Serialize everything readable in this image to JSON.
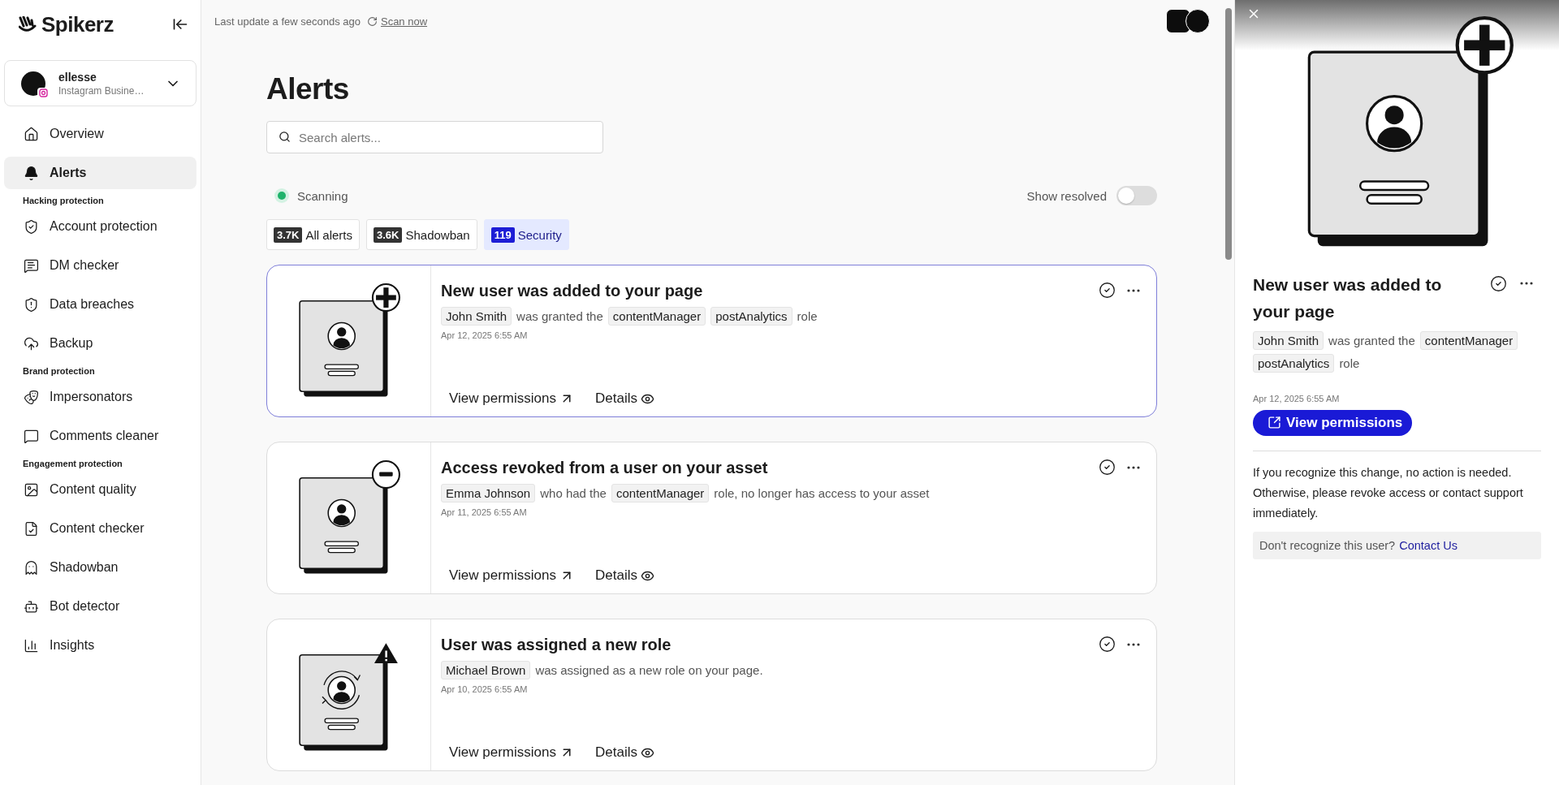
{
  "sidebar": {
    "logo": "Spikerz",
    "account": {
      "name": "ellesse",
      "subtitle": "Instagram Busine…"
    },
    "nav": [
      {
        "label": "Overview",
        "selected": false
      },
      {
        "label": "Alerts",
        "selected": true
      }
    ],
    "sections": [
      {
        "heading": "Hacking protection",
        "items": [
          {
            "label": "Account protection",
            "selected": false
          },
          {
            "label": "DM checker",
            "selected": false
          },
          {
            "label": "Data breaches",
            "selected": false
          },
          {
            "label": "Backup",
            "selected": false
          }
        ]
      },
      {
        "heading": "Brand protection",
        "items": [
          {
            "label": "Impersonators",
            "selected": false
          },
          {
            "label": "Comments cleaner",
            "selected": false
          }
        ]
      },
      {
        "heading": "Engagement protection",
        "items": [
          {
            "label": "Content quality",
            "selected": false
          },
          {
            "label": "Content checker",
            "selected": false
          },
          {
            "label": "Shadowban",
            "selected": false
          },
          {
            "label": "Bot detector",
            "selected": false
          },
          {
            "label": "Insights",
            "selected": false
          }
        ]
      }
    ]
  },
  "topbar": {
    "status": "Last update a few seconds ago",
    "scan_link": "Scan now"
  },
  "page": {
    "title": "Alerts",
    "search": {
      "placeholder": "Search alerts..."
    },
    "scanning": {
      "label": "Scanning",
      "active": true
    },
    "show_resolved": {
      "label": "Show resolved",
      "on": false
    },
    "filters": [
      {
        "count": "3.7K",
        "label": "All alerts",
        "selected": false
      },
      {
        "count": "3.6K",
        "label": "Shadowban",
        "selected": false
      },
      {
        "count": "119",
        "label": "Security",
        "selected": true
      }
    ]
  },
  "alerts": [
    {
      "kind": "added",
      "selected": true,
      "title": "New user was added to your page",
      "description": [
        {
          "kind": "tag",
          "text": "John Smith"
        },
        {
          "kind": "text",
          "text": "was granted the"
        },
        {
          "kind": "tag",
          "text": "contentManager"
        },
        {
          "kind": "tag",
          "text": "postAnalytics"
        },
        {
          "kind": "text",
          "text": "role"
        }
      ],
      "date": "Apr 12, 2025 6:55 AM",
      "actions": [
        "View permissions",
        "Details"
      ]
    },
    {
      "kind": "revoked",
      "selected": false,
      "title": "Access revoked from a user on your asset",
      "description": [
        {
          "kind": "tag",
          "text": "Emma Johnson"
        },
        {
          "kind": "text",
          "text": "who had the"
        },
        {
          "kind": "tag",
          "text": "contentManager"
        },
        {
          "kind": "text",
          "text": "role, no longer has access to your asset"
        }
      ],
      "date": "Apr 11, 2025 6:55 AM",
      "actions": [
        "View permissions",
        "Details"
      ]
    },
    {
      "kind": "assigned",
      "selected": false,
      "title": "User was assigned a new role",
      "description": [
        {
          "kind": "tag",
          "text": "Michael Brown"
        },
        {
          "kind": "text",
          "text": "was assigned as a new role on your page."
        }
      ],
      "date": "Apr 10, 2025 6:55 AM",
      "actions": [
        "View permissions",
        "Details"
      ]
    }
  ],
  "detail_panel": {
    "kind": "added",
    "title": "New user was added to your page",
    "description": [
      {
        "kind": "tag",
        "text": "John Smith"
      },
      {
        "kind": "text",
        "text": "was granted the"
      },
      {
        "kind": "tag",
        "text": "contentManager"
      },
      {
        "kind": "tag",
        "text": "postAnalytics"
      },
      {
        "kind": "text",
        "text": "role"
      }
    ],
    "date": "Apr 12, 2025 6:55 AM",
    "button": "View permissions",
    "note": "If you recognize this change, no action is needed. Otherwise, please revoke access or contact support immediately.",
    "help": {
      "text": "Don't recognize this user?",
      "link": "Contact Us"
    }
  }
}
